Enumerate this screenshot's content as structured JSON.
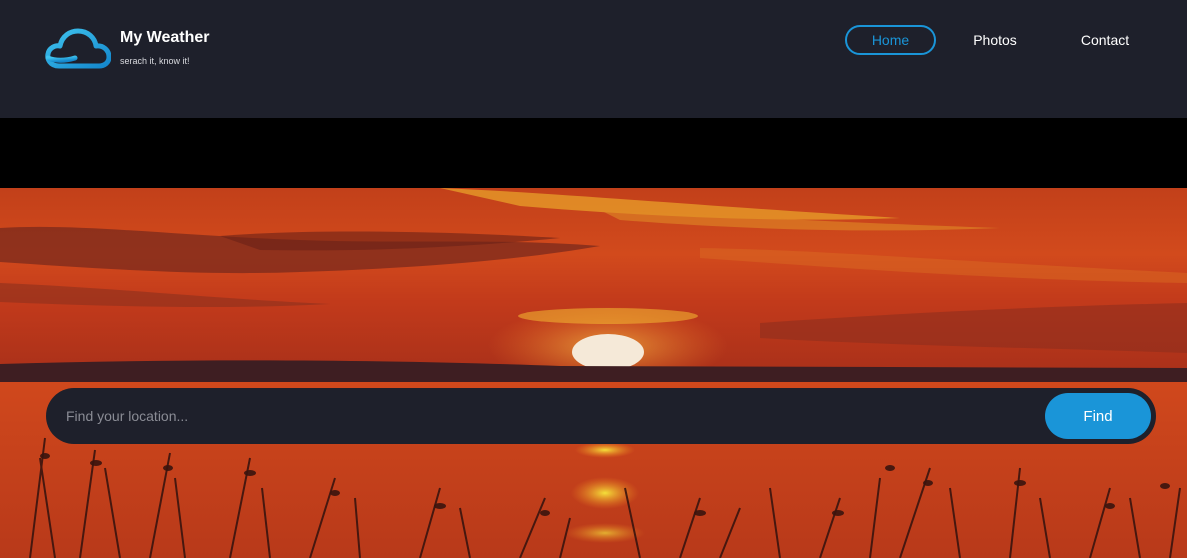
{
  "brand": {
    "title": "My Weather",
    "tagline": "serach it, know it!",
    "logo_icon": "cloud-icon",
    "accent_color": "#1a95d8"
  },
  "nav": {
    "items": [
      {
        "label": "Home",
        "active": true
      },
      {
        "label": "Photos",
        "active": false
      },
      {
        "label": "Contact",
        "active": false
      }
    ]
  },
  "search": {
    "placeholder": "Find your location...",
    "value": "",
    "button_label": "Find"
  },
  "colors": {
    "header_bg": "#1e202b",
    "accent": "#1a95d8",
    "text": "#ffffff"
  }
}
